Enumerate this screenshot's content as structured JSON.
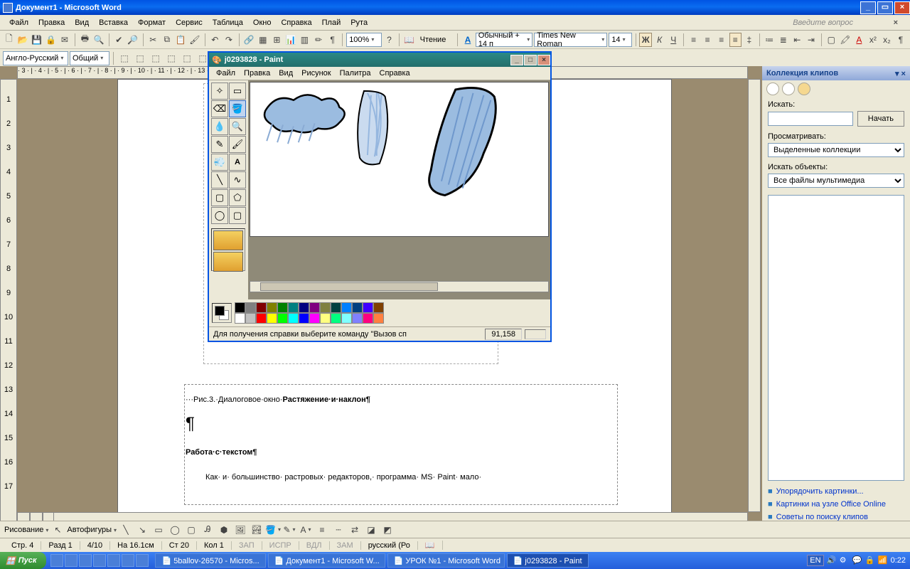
{
  "window": {
    "title": "Документ1 - Microsoft Word"
  },
  "menu": [
    "Файл",
    "Правка",
    "Вид",
    "Вставка",
    "Формат",
    "Сервис",
    "Таблица",
    "Окно",
    "Справка",
    "Плай",
    "Рута"
  ],
  "ask_question": "Введите вопрос",
  "toolbar1": {
    "zoom": "100%",
    "read": "Чтение"
  },
  "toolbar2": {
    "lang": "Англо-Русский",
    "mode": "Общий"
  },
  "format": {
    "style": "Обычный + 14 п",
    "font": "Times New Roman",
    "size": "14"
  },
  "ruler_h": "   · 3 · | · 4 · | · 5 · | · 6 · | · 7 · | · 8 · | · 9 · | · 10 · | · 11 · | · 12 · | · 13 · |      · 14 · | · 15 · | · 16 · | · 17 ·",
  "ruler_v": [
    "1",
    "2",
    "3",
    "4",
    "5",
    "6",
    "7",
    "8",
    "9",
    "10",
    "11",
    "12",
    "13",
    "14",
    "15",
    "16",
    "17"
  ],
  "doc": {
    "fig_prefix": "···Рис.3.·Диалоговое·окно·",
    "fig_bold": "Растяжение·и·наклон¶",
    "para_mark": "¶",
    "heading": "Работа·с·текстом¶",
    "body": "Как· и· большинство· растровых· редакторов,· программа· MS· Paint· мало·"
  },
  "clipart": {
    "title": "Коллекция клипов",
    "search_lbl": "Искать:",
    "search_val": "",
    "go": "Начать",
    "browse_lbl": "Просматривать:",
    "browse_val": "Выделенные коллекции",
    "types_lbl": "Искать объекты:",
    "types_val": "Все файлы мультимедиа",
    "link1": "Упорядочить картинки...",
    "link2": "Картинки на узле Office Online",
    "link3": "Советы по поиску клипов"
  },
  "paint": {
    "title": "j0293828 - Paint",
    "menu": [
      "Файл",
      "Правка",
      "Вид",
      "Рисунок",
      "Палитра",
      "Справка"
    ],
    "status": "Для получения справки выберите команду \"Вызов сп",
    "coord": "91,158",
    "palette_top": [
      "#000000",
      "#808080",
      "#800000",
      "#808000",
      "#008000",
      "#008080",
      "#000080",
      "#800080",
      "#808040",
      "#004040",
      "#0080ff",
      "#004080",
      "#4000ff",
      "#804000"
    ],
    "palette_bot": [
      "#ffffff",
      "#c0c0c0",
      "#ff0000",
      "#ffff00",
      "#00ff00",
      "#00ffff",
      "#0000ff",
      "#ff00ff",
      "#ffff80",
      "#00ff80",
      "#80ffff",
      "#8080ff",
      "#ff0080",
      "#ff8040"
    ]
  },
  "drawbar": {
    "label": "Рисование",
    "autoshapes": "Автофигуры"
  },
  "status": {
    "page": "Стр. 4",
    "section": "Разд 1",
    "pages": "4/10",
    "pos": "На 16.1см",
    "line": "Ст 20",
    "col": "Кол 1",
    "rec": "ЗАП",
    "trk": "ИСПР",
    "ext": "ВДЛ",
    "ovr": "ЗАМ",
    "lang": "русский (Ро"
  },
  "taskbar": {
    "start": "Пуск",
    "items": [
      "5ballov-26570 - Micros...",
      "Документ1 - Microsoft W...",
      "УРОК №1 - Microsoft Word",
      "j0293828 - Paint"
    ],
    "lang": "EN",
    "time": "0:22"
  }
}
